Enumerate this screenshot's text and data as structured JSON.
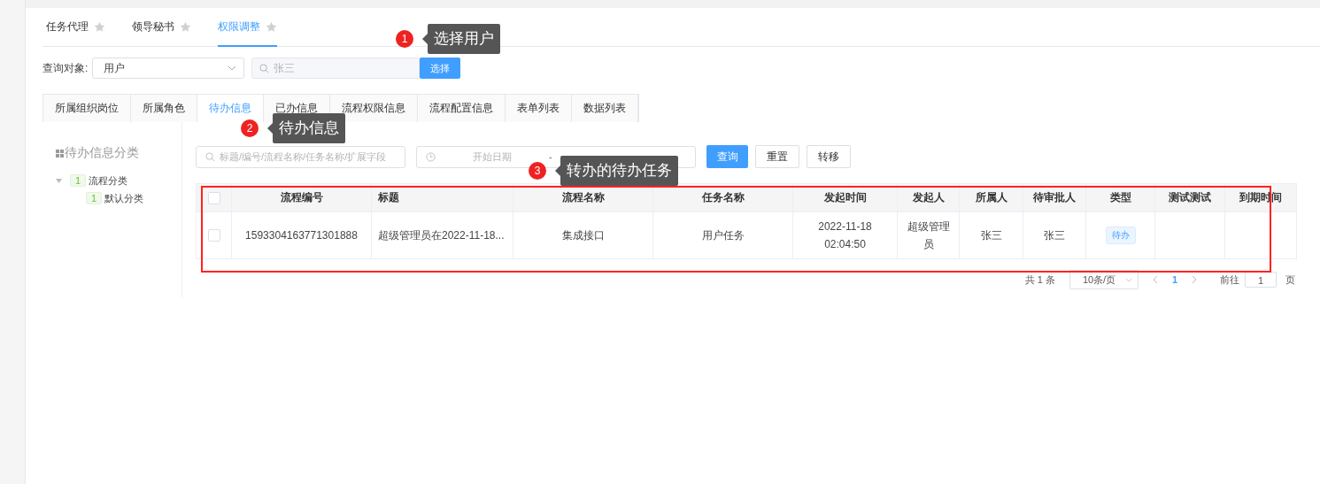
{
  "top_tabs": [
    {
      "label": "任务代理",
      "selected": false
    },
    {
      "label": "领导秘书",
      "selected": false
    },
    {
      "label": "权限调整",
      "selected": true
    }
  ],
  "query": {
    "label": "查询对象:",
    "type_value": "用户",
    "search_value": "张三",
    "select_button": "选择"
  },
  "sub_tabs": [
    {
      "label": "所属组织岗位",
      "selected": false
    },
    {
      "label": "所属角色",
      "selected": false
    },
    {
      "label": "待办信息",
      "selected": true
    },
    {
      "label": "已办信息",
      "selected": false
    },
    {
      "label": "流程权限信息",
      "selected": false
    },
    {
      "label": "流程配置信息",
      "selected": false
    },
    {
      "label": "表单列表",
      "selected": false
    },
    {
      "label": "数据列表",
      "selected": false
    }
  ],
  "tree": {
    "title": "待办信息分类",
    "items": [
      {
        "count": "1",
        "label": "流程分类",
        "expanded": true,
        "children": [
          {
            "count": "1",
            "label": "默认分类"
          }
        ]
      }
    ]
  },
  "filters": {
    "keyword_placeholder": "标题/编号/流程名称/任务名称/扩展字段",
    "start_placeholder": "开始日期",
    "separator": "-",
    "buttons": [
      "查询",
      "重置",
      "转移"
    ]
  },
  "table": {
    "all_checked": false,
    "columns": [
      "流程编号",
      "标题",
      "流程名称",
      "任务名称",
      "发起时间",
      "发起人",
      "所属人",
      "待审批人",
      "类型",
      "测试测试",
      "到期时间"
    ],
    "rows": [
      {
        "checked": false,
        "cells": [
          "1593304163771301888",
          "超级管理员在2022-11-18...",
          "集成接口",
          "用户任务",
          "2022-11-18 02:04:50",
          "超级管理员",
          "张三",
          "张三",
          "待办",
          "",
          ""
        ]
      }
    ]
  },
  "pagination": {
    "total": "共 1 条",
    "page_size": "10条/页",
    "current": "1",
    "goto_label": "前往",
    "goto_value": "1",
    "page_suffix": "页"
  },
  "annotations": [
    {
      "number": "1",
      "text": "选择用户"
    },
    {
      "number": "2",
      "text": "待办信息"
    },
    {
      "number": "3",
      "text": "转办的待办任务"
    }
  ]
}
